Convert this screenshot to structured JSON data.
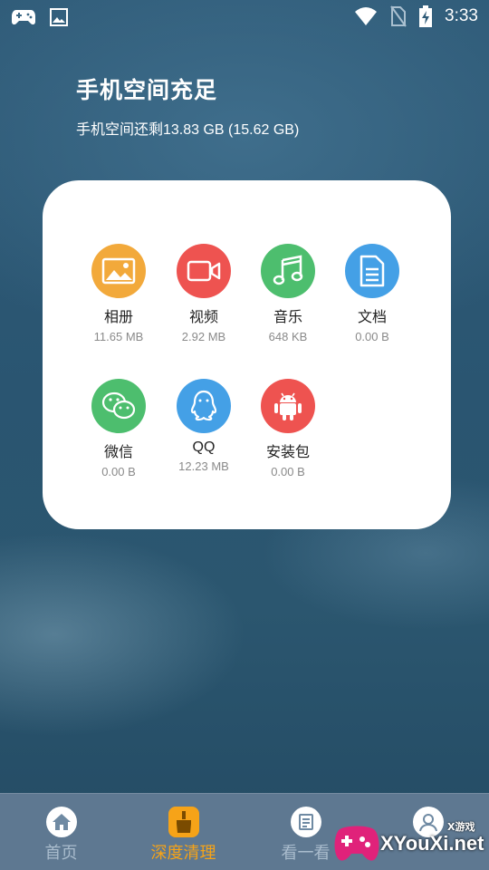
{
  "status_bar": {
    "time": "3:33",
    "icons": [
      "game-controller-icon",
      "image-icon",
      "wifi-icon",
      "no-sim-icon",
      "battery-charging-icon"
    ]
  },
  "header": {
    "title": "手机空间充足",
    "subtitle": "手机空间还剩13.83 GB (15.62 GB)"
  },
  "categories": [
    {
      "name": "相册",
      "size": "11.65 MB",
      "icon": "photo-icon",
      "color": "#f2a93b"
    },
    {
      "name": "视频",
      "size": "2.92 MB",
      "icon": "video-icon",
      "color": "#ee5350"
    },
    {
      "name": "音乐",
      "size": "648 KB",
      "icon": "music-icon",
      "color": "#4dbe6e"
    },
    {
      "name": "文档",
      "size": "0.00 B",
      "icon": "document-icon",
      "color": "#44a0e6"
    },
    {
      "name": "微信",
      "size": "0.00 B",
      "icon": "wechat-icon",
      "color": "#4dbe6e"
    },
    {
      "name": "QQ",
      "size": "12.23 MB",
      "icon": "qq-icon",
      "color": "#44a0e6"
    },
    {
      "name": "安装包",
      "size": "0.00 B",
      "icon": "android-icon",
      "color": "#ee5350"
    }
  ],
  "tabs": [
    {
      "label": "首页",
      "icon": "home-icon",
      "active": false
    },
    {
      "label": "深度清理",
      "icon": "broom-icon",
      "active": true
    },
    {
      "label": "看一看",
      "icon": "news-icon",
      "active": false
    },
    {
      "label": "",
      "icon": "profile-icon",
      "active": false
    }
  ],
  "watermark": {
    "text": "XYouXi.net",
    "tag": "X游戏"
  },
  "colors": {
    "accent": "#f6a318",
    "tabbar_bg": "#5e7891",
    "tab_inactive": "#a9bccd"
  }
}
